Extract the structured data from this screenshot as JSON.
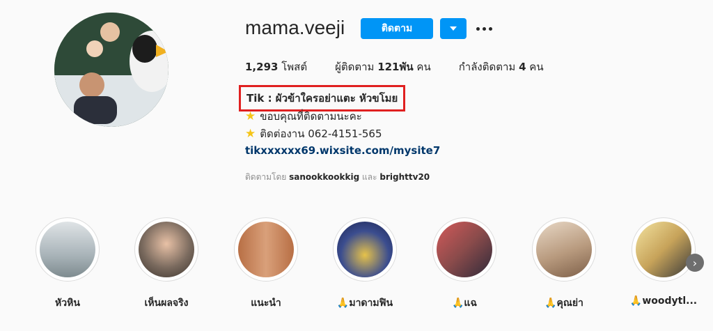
{
  "profile": {
    "username": "mama.veeji",
    "follow_label": "ติดตาม",
    "stats": {
      "posts_count": "1,293",
      "posts_label": "โพสต์",
      "followers_label": "ผู้ติดตาม",
      "followers_count": "121พัน",
      "followers_unit": "คน",
      "following_label": "กำลังติดตาม",
      "following_count": "4",
      "following_unit": "คน"
    },
    "bio": {
      "name": "Tik : ผัวข้าใครอย่าแตะ หัวขโมย",
      "line1": "ขอบคุณที่ติดตามนะคะ",
      "line2": "ติดต่องาน 062-4151-565",
      "link": "tikxxxxxx69.wixsite.com/mysite7"
    },
    "followed_by": {
      "prefix": "ติดตามโดย",
      "user1": "sanookkookkig",
      "conj": "และ",
      "user2": "brighttv20"
    }
  },
  "highlights": [
    {
      "label": "หัวหิน",
      "color": "#a9b4b9"
    },
    {
      "label": "เห็นผลจริง",
      "color": "#7a6a5e"
    },
    {
      "label": "แนะนำ",
      "color": "#c9855f"
    },
    {
      "label": "🙏มาดามฟิน",
      "color": "#3b4d8f"
    },
    {
      "label": "🙏แฉ",
      "color": "#8a4b4b"
    },
    {
      "label": "🙏คุณย่า",
      "color": "#b89a7e"
    },
    {
      "label": "🙏woodytl...",
      "color": "#c7a35a"
    }
  ],
  "icons": {
    "dropdown": "chevron-down-icon",
    "more": "more-horizontal-icon",
    "star": "star-icon",
    "next": "chevron-right-icon"
  },
  "colors": {
    "accent": "#0095f6",
    "highlight_box": "#e02020",
    "link": "#00376b"
  }
}
